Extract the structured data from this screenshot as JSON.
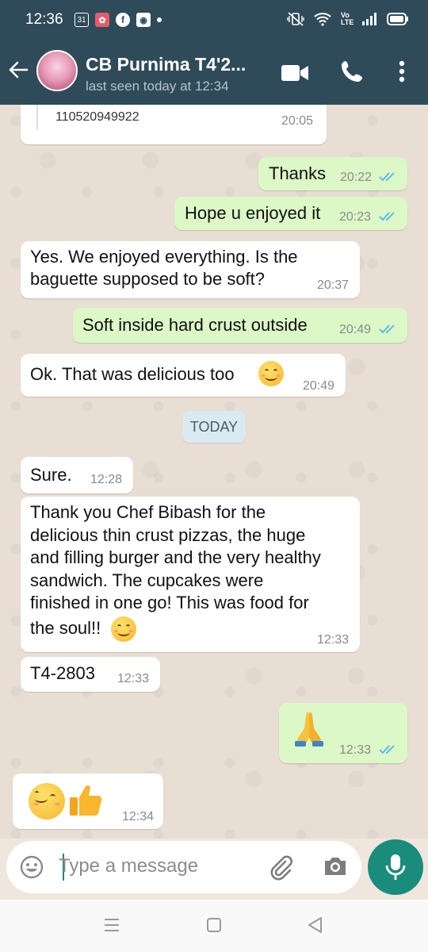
{
  "status_bar": {
    "time": "12:36",
    "calendar_badge": "31",
    "facebook_badge": "f",
    "volte_label": "Vo LTE"
  },
  "header": {
    "contact_name": "CB Purnima T4'2...",
    "last_seen": "last seen today at 12:34",
    "icons": [
      "back-arrow-icon",
      "video-call-icon",
      "phone-icon",
      "more-vert-icon"
    ]
  },
  "messages": [
    {
      "dir": "in",
      "text": "110520949922",
      "time": "20:05"
    },
    {
      "dir": "out",
      "text": "Thanks",
      "time": "20:22",
      "status": "read"
    },
    {
      "dir": "out",
      "text": "Hope u enjoyed it",
      "time": "20:23",
      "status": "read"
    },
    {
      "dir": "in",
      "line1": "Yes. We enjoyed everything. Is the",
      "line2": "baguette supposed to be soft?",
      "time": "20:37"
    },
    {
      "dir": "out",
      "text": "Soft inside hard crust outside",
      "time": "20:49",
      "status": "read"
    },
    {
      "dir": "in",
      "text": "Ok. That was delicious too",
      "emoji": "smiling-face",
      "time": "20:49"
    },
    {
      "dir": "in",
      "text": "Sure.",
      "time": "12:28"
    },
    {
      "dir": "in",
      "line1": "Thank you Chef Bibash for the",
      "line2": "delicious thin crust pizzas, the huge",
      "line3": "and filling burger and the very healthy",
      "line4": "sandwich. The cupcakes were",
      "line5": "finished in one go! This was food for",
      "line6": "the soul!!",
      "emoji": "smiling-face",
      "time": "12:33"
    },
    {
      "dir": "in",
      "text": "T4-2803",
      "time": "12:33"
    },
    {
      "dir": "out",
      "emoji": "folded-hands",
      "time": "12:33",
      "status": "read"
    },
    {
      "dir": "in",
      "emoji": "smiling-face thumbs-up",
      "time": "12:34"
    }
  ],
  "date_divider": "TODAY",
  "composer": {
    "placeholder": "Type a message"
  },
  "colors": {
    "header_bg": "#2f4b59",
    "incoming_bubble": "#ffffff",
    "outgoing_bubble": "#dcf8c6",
    "read_tick": "#4fb6ec",
    "accent": "#1a8c7c"
  }
}
